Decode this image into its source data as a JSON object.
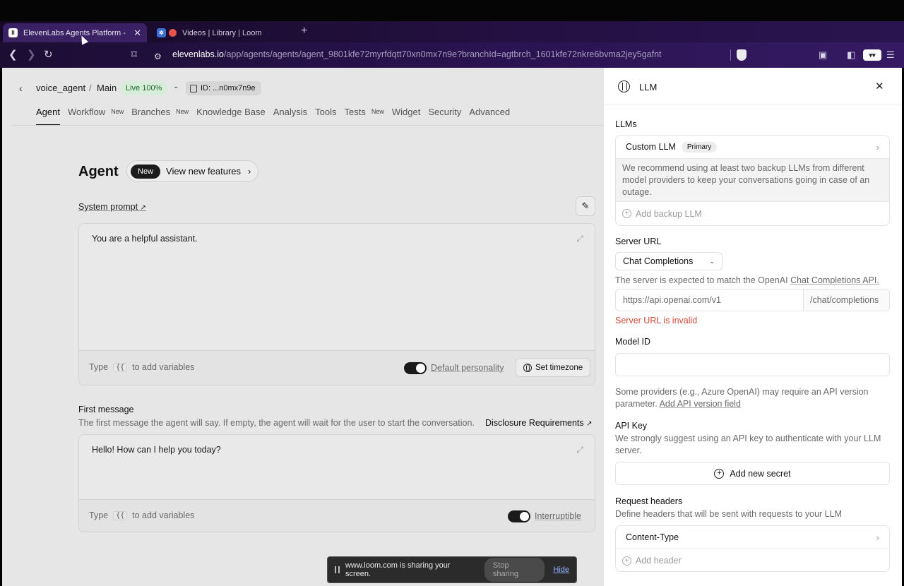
{
  "browser": {
    "tabs": [
      {
        "title": "ElevenLabs Agents Platform -",
        "active": true,
        "icon": "elevenlabs-favicon"
      },
      {
        "title": "Videos | Library | Loom",
        "active": false,
        "icon": "loom-favicon"
      }
    ],
    "url_host": "elevenlabs.io",
    "url_path": "/app/agents/agents/agent_9801kfe72myrfdqtt70xn0mx7n9e?branchId=agtbrch_1601kfe72nkre6bvma2jey5gafnt"
  },
  "header": {
    "agent_name": "voice_agent",
    "separator": "/",
    "branch": "Main",
    "live_badge": "Live 100%",
    "id_label": "ID: ...n0mx7n9e"
  },
  "nav_tabs": [
    {
      "label": "Agent",
      "new": false,
      "active": true
    },
    {
      "label": "Workflow",
      "new": true
    },
    {
      "label": "Branches",
      "new": true
    },
    {
      "label": "Knowledge Base",
      "new": false
    },
    {
      "label": "Analysis",
      "new": false
    },
    {
      "label": "Tools",
      "new": false
    },
    {
      "label": "Tests",
      "new": true
    },
    {
      "label": "Widget",
      "new": false
    },
    {
      "label": "Security",
      "new": false
    },
    {
      "label": "Advanced",
      "new": false
    }
  ],
  "new_tag": "New",
  "agent": {
    "title": "Agent",
    "features_badge": "New",
    "features_label": "View new features",
    "system_prompt_label": "System prompt",
    "system_prompt_text": "You are a helpful assistant.",
    "variables_hint_pre": "Type",
    "variables_hint_brace": "{{",
    "variables_hint_post": "to add variables",
    "default_personality_label": "Default personality",
    "set_timezone_label": "Set timezone",
    "first_message_title": "First message",
    "first_message_desc": "The first message the agent will say. If empty, the agent will wait for the user to start the conversation.",
    "disclosure_link": "Disclosure Requirements",
    "first_message_text": "Hello! How can I help you today?",
    "interruptible_label": "Interruptible"
  },
  "panel": {
    "title": "LLM",
    "llms_label": "LLMs",
    "custom_llm": "Custom LLM",
    "primary_badge": "Primary",
    "backup_warning": "We recommend using at least two backup LLMs from different model providers to keep your conversations going in case of an outage.",
    "add_backup": "Add backup LLM",
    "server_url_label": "Server URL",
    "server_type": "Chat Completions",
    "server_desc_pre": "The server is expected to match the OpenAI",
    "server_desc_link": "Chat Completions API.",
    "url_placeholder": "https://api.openai.com/v1",
    "url_suffix": "/chat/completions",
    "url_error": "Server URL is invalid",
    "model_id_label": "Model ID",
    "model_id_value": "",
    "api_version_desc": "Some providers (e.g., Azure OpenAI) may require an API version parameter.",
    "api_version_link": "Add API version field",
    "api_key_label": "API Key",
    "api_key_desc": "We strongly suggest using an API key to authenticate with your LLM server.",
    "add_secret": "Add new secret",
    "request_headers_label": "Request headers",
    "request_headers_desc": "Define headers that will be sent with requests to your LLM",
    "header_item": "Content-Type",
    "add_header": "Add header"
  },
  "sharebar": {
    "message": "www.loom.com is sharing your screen.",
    "stop": "Stop sharing",
    "hide": "Hide"
  },
  "colors": {
    "error": "#d54a3a",
    "live_badge_bg": "#d7ecd9",
    "live_badge_text": "#1d6b2e"
  }
}
